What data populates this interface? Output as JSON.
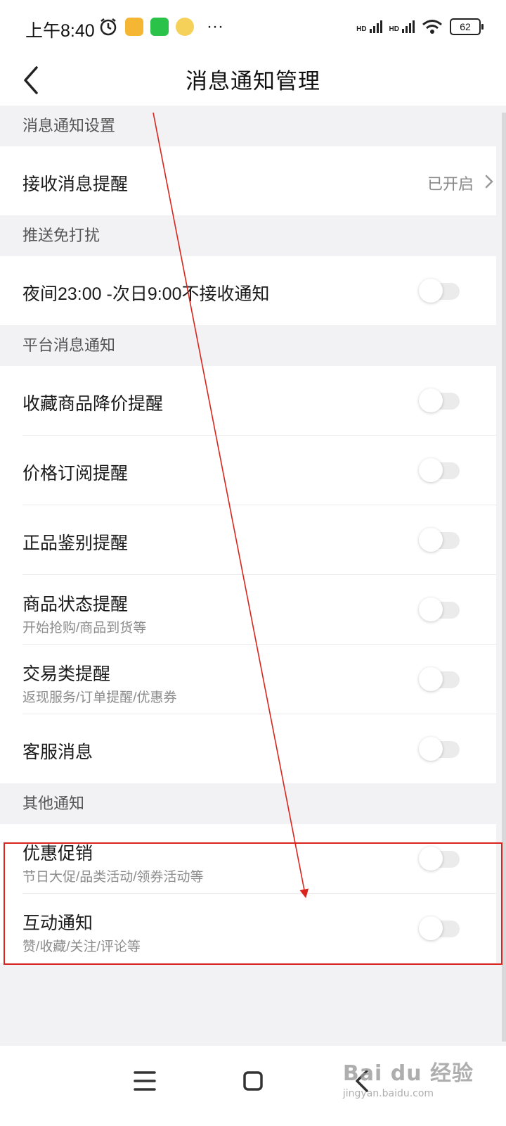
{
  "status_bar": {
    "time": "上午8:40",
    "more": "···",
    "network_1": "HD",
    "network_2": "HD",
    "battery": "62",
    "app_icons": [
      "alarm-icon",
      "notes-app-icon",
      "wechat-icon",
      "weibo-icon"
    ]
  },
  "header": {
    "title": "消息通知管理"
  },
  "sections": [
    {
      "title": "消息通知设置",
      "rows": [
        {
          "label": "接收消息提醒",
          "value": "已开启",
          "type": "link"
        }
      ]
    },
    {
      "title": "推送免打扰",
      "rows": [
        {
          "label": "夜间23:00 -次日9:00不接收通知",
          "type": "toggle",
          "on": false
        }
      ]
    },
    {
      "title": "平台消息通知",
      "rows": [
        {
          "label": "收藏商品降价提醒",
          "type": "toggle",
          "on": false
        },
        {
          "label": "价格订阅提醒",
          "type": "toggle",
          "on": false
        },
        {
          "label": "正品鉴别提醒",
          "type": "toggle",
          "on": false
        },
        {
          "label": "商品状态提醒",
          "sub": "开始抢购/商品到货等",
          "type": "toggle",
          "on": false
        },
        {
          "label": "交易类提醒",
          "sub": "返现服务/订单提醒/优惠券",
          "type": "toggle",
          "on": false
        },
        {
          "label": "客服消息",
          "type": "toggle",
          "on": false
        }
      ]
    },
    {
      "title": "其他通知",
      "rows": [
        {
          "label": "优惠促销",
          "sub": "节日大促/品类活动/领券活动等",
          "type": "toggle",
          "on": false
        },
        {
          "label": "互动通知",
          "sub": "赞/收藏/关注/评论等",
          "type": "toggle",
          "on": false
        }
      ]
    }
  ],
  "nav_bar": {
    "buttons": [
      "menu-icon",
      "home-icon",
      "back-icon"
    ]
  },
  "watermark": {
    "logo": "Bai du 经验",
    "url": "jingyan.baidu.com"
  },
  "colors": {
    "background": "#f2f2f4",
    "card": "#ffffff",
    "annotation_red": "#d9251d",
    "toggle_off": "#ebebeb"
  }
}
